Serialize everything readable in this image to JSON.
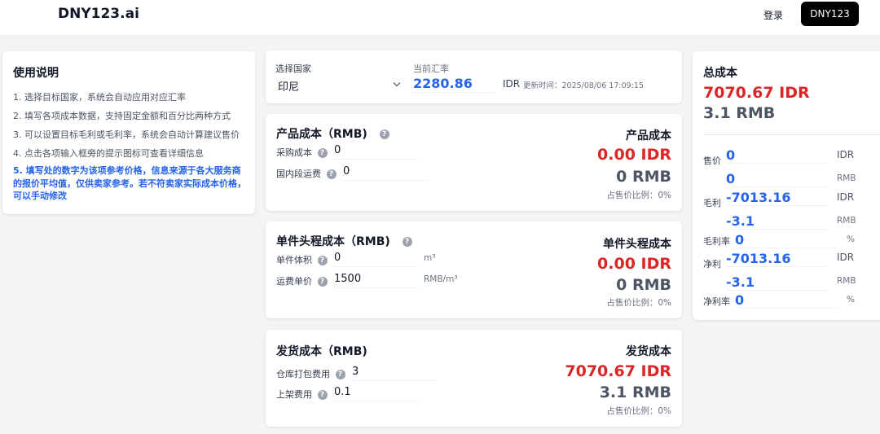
{
  "header": {
    "logo": "DNY123.ai",
    "login": "登录",
    "brand_button": "DNY123"
  },
  "instructions": {
    "title": "使用说明",
    "items": [
      "1. 选择目标国家，系统会自动应用对应汇率",
      "2. 填写各项成本数据，支持固定金额和百分比两种方式",
      "3. 可以设置目标毛利或毛利率，系统会自动计算建议售价",
      "4. 点击各项输入框旁的提示图标可查看详细信息"
    ],
    "highlight": "5. 填写处的数字为该项参考价格，信息来源于各大服务商的报价平均值，仅供卖家参考。若不符卖家实际成本价格，可以手动修改"
  },
  "country": {
    "label": "选择国家",
    "value": "印尼",
    "rate_label": "当前汇率",
    "rate_value": "2280.86",
    "rate_unit": "IDR",
    "updated": "更新时间：2025/08/06 17:09:15"
  },
  "product_cost": {
    "title": "产品成本（RMB)",
    "fields": [
      {
        "label": "采购成本",
        "value": "0"
      },
      {
        "label": "国内段运费",
        "value": "0"
      }
    ],
    "summary_title": "产品成本",
    "idr": "0.00 IDR",
    "rmb": "0 RMB",
    "ratio": "占售价比例：0%"
  },
  "shipping_cost": {
    "title": "单件头程成本（RMB)",
    "fields": [
      {
        "label": "单件体积",
        "value": "0",
        "unit": "m³"
      },
      {
        "label": "运费单价",
        "value": "1500",
        "unit": "RMB/m³"
      }
    ],
    "summary_title": "单件头程成本",
    "idr": "0.00 IDR",
    "rmb": "0 RMB",
    "ratio": "占售价比例：0%"
  },
  "delivery_cost": {
    "title": "发货成本（RMB)",
    "fields": [
      {
        "label": "仓库打包费用",
        "value": "3"
      },
      {
        "label": "上架费用",
        "value": "0.1"
      }
    ],
    "summary_title": "发货成本",
    "idr": "7070.67 IDR",
    "rmb": "3.1 RMB",
    "ratio": "占售价比例：0%"
  },
  "total": {
    "title": "总成本",
    "idr": "7070.67 IDR",
    "rmb": "3.1 RMB",
    "rows": [
      {
        "label": "售价",
        "idr_value": "0",
        "idr_unit": "IDR",
        "rmb_value": "0",
        "rmb_unit": "RMB"
      },
      {
        "label": "毛利",
        "idr_value": "-7013.16",
        "idr_unit": "IDR",
        "rmb_value": "-3.1",
        "rmb_unit": "RMB"
      },
      {
        "label": "毛利率",
        "value": "0",
        "unit": "%"
      },
      {
        "label": "净利",
        "idr_value": "-7013.16",
        "idr_unit": "IDR",
        "rmb_value": "-3.1",
        "rmb_unit": "RMB"
      },
      {
        "label": "净利率",
        "value": "0",
        "unit": "%"
      }
    ]
  },
  "help_glyph": "?",
  "colors": {
    "accent_blue": "#2563eb",
    "negative_red": "#dc2626",
    "brand_black": "#000000"
  }
}
